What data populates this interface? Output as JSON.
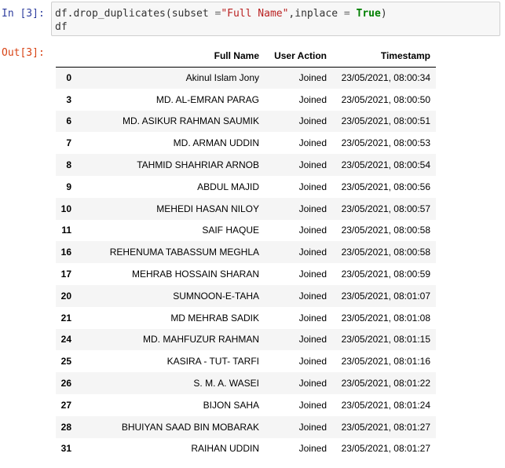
{
  "cell_in": {
    "prompt": "In [3]:",
    "code": {
      "line1_a": "df.drop_duplicates(subset ",
      "line1_op": "=",
      "line1_str": "\"Full Name\"",
      "line1_b": ",inplace ",
      "line1_op2": "=",
      "line1_c": " ",
      "line1_kw": "True",
      "line1_d": ")",
      "line2": "df"
    }
  },
  "cell_out": {
    "prompt": "Out[3]:"
  },
  "table": {
    "columns": [
      "",
      "Full Name",
      "User Action",
      "Timestamp"
    ],
    "rows": [
      {
        "index": "0",
        "name": "Akinul Islam Jony",
        "action": "Joined",
        "time": "23/05/2021, 08:00:34"
      },
      {
        "index": "3",
        "name": "MD. AL-EMRAN PARAG",
        "action": "Joined",
        "time": "23/05/2021, 08:00:50"
      },
      {
        "index": "6",
        "name": "MD. ASIKUR RAHMAN SAUMIK",
        "action": "Joined",
        "time": "23/05/2021, 08:00:51"
      },
      {
        "index": "7",
        "name": "MD. ARMAN UDDIN",
        "action": "Joined",
        "time": "23/05/2021, 08:00:53"
      },
      {
        "index": "8",
        "name": "TAHMID SHAHRIAR ARNOB",
        "action": "Joined",
        "time": "23/05/2021, 08:00:54"
      },
      {
        "index": "9",
        "name": "ABDUL MAJID",
        "action": "Joined",
        "time": "23/05/2021, 08:00:56"
      },
      {
        "index": "10",
        "name": "MEHEDI HASAN NILOY",
        "action": "Joined",
        "time": "23/05/2021, 08:00:57"
      },
      {
        "index": "11",
        "name": "SAIF HAQUE",
        "action": "Joined",
        "time": "23/05/2021, 08:00:58"
      },
      {
        "index": "16",
        "name": "REHENUMA TABASSUM MEGHLA",
        "action": "Joined",
        "time": "23/05/2021, 08:00:58"
      },
      {
        "index": "17",
        "name": "MEHRAB HOSSAIN SHARAN",
        "action": "Joined",
        "time": "23/05/2021, 08:00:59"
      },
      {
        "index": "20",
        "name": "SUMNOON-E-TAHA",
        "action": "Joined",
        "time": "23/05/2021, 08:01:07"
      },
      {
        "index": "21",
        "name": "MD MEHRAB SADIK",
        "action": "Joined",
        "time": "23/05/2021, 08:01:08"
      },
      {
        "index": "24",
        "name": "MD. MAHFUZUR RAHMAN",
        "action": "Joined",
        "time": "23/05/2021, 08:01:15"
      },
      {
        "index": "25",
        "name": "KASIRA - TUT- TARFI",
        "action": "Joined",
        "time": "23/05/2021, 08:01:16"
      },
      {
        "index": "26",
        "name": "S. M. A. WASEI",
        "action": "Joined",
        "time": "23/05/2021, 08:01:22"
      },
      {
        "index": "27",
        "name": "BIJON SAHA",
        "action": "Joined",
        "time": "23/05/2021, 08:01:24"
      },
      {
        "index": "28",
        "name": "BHUIYAN SAAD BIN MOBARAK",
        "action": "Joined",
        "time": "23/05/2021, 08:01:27"
      },
      {
        "index": "31",
        "name": "RAIHAN UDDIN",
        "action": "Joined",
        "time": "23/05/2021, 08:01:27"
      }
    ]
  },
  "colors": {
    "in_prompt": "#303F9F",
    "out_prompt": "#D84315",
    "string": "#BA2121",
    "keyword": "#008000"
  }
}
